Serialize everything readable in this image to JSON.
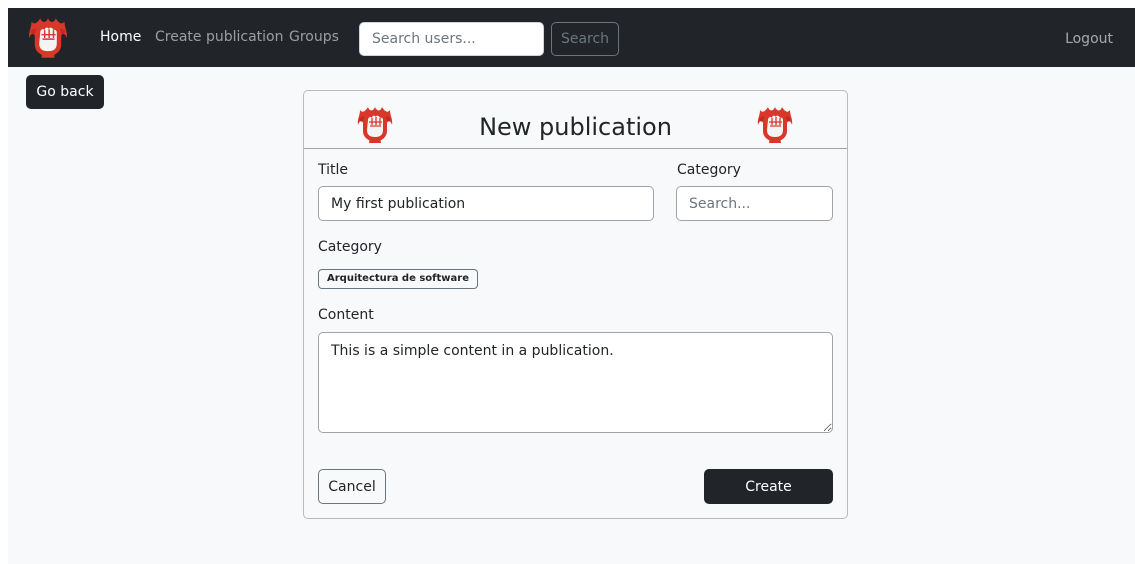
{
  "navbar": {
    "logo_icon": "flaming-fist-logo",
    "links": [
      {
        "label": "Home",
        "active": true
      },
      {
        "label": "Create publication",
        "active": false
      },
      {
        "label": "Groups",
        "active": false
      }
    ],
    "search": {
      "placeholder": "Search users...",
      "value": "",
      "button_label": "Search"
    },
    "logout_label": "Logout"
  },
  "go_back_label": "Go back",
  "form": {
    "title": "New publication",
    "header_icon": "flaming-fist-logo",
    "title_field": {
      "label": "Title",
      "value": "My first publication"
    },
    "category_search": {
      "label": "Category",
      "placeholder": "Search..."
    },
    "selected_categories": {
      "label": "Category",
      "items": [
        "Arquitectura de software"
      ]
    },
    "content_field": {
      "label": "Content",
      "value": "This is a simple content in a publication."
    },
    "cancel_label": "Cancel",
    "create_label": "Create"
  },
  "colors": {
    "navbar_bg": "#212529",
    "page_bg": "#f8f9fa",
    "logo_red": "#d9372a",
    "button_dark": "#212529"
  }
}
